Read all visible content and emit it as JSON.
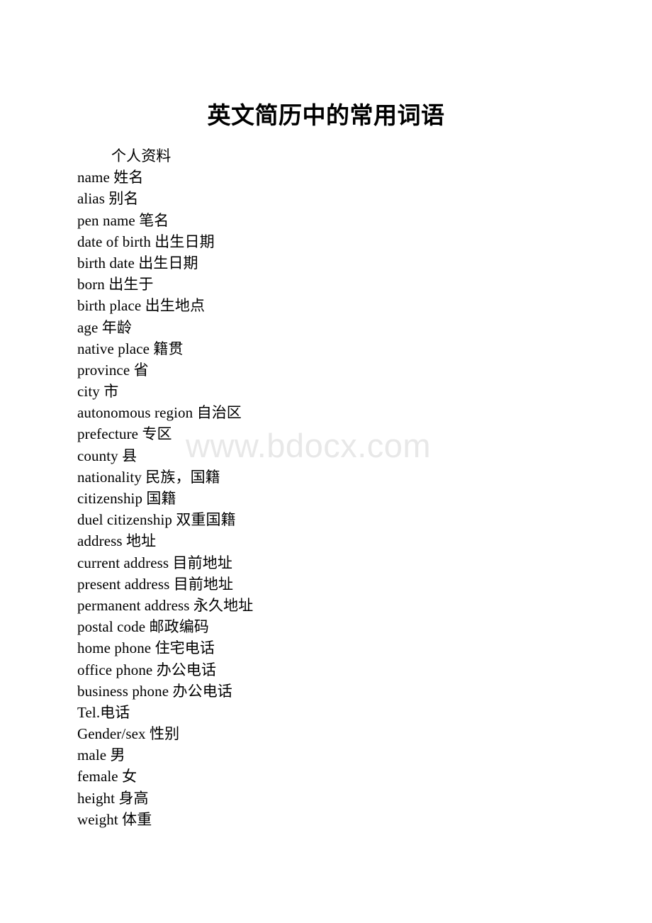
{
  "document": {
    "title": "英文简历中的常用词语",
    "watermark": "www.bdocx.com",
    "section_heading": "个人资料",
    "lines": [
      "个人资料",
      "name 姓名",
      "alias 别名",
      "pen name 笔名",
      "date of birth 出生日期",
      "birth date 出生日期",
      "born 出生于",
      "birth place 出生地点",
      "age 年龄",
      "native place 籍贯",
      "province 省",
      "city 市",
      "autonomous region 自治区",
      "prefecture 专区",
      "county 县",
      "nationality 民族，国籍",
      "citizenship 国籍",
      "duel citizenship 双重国籍",
      "address 地址",
      "current address 目前地址",
      "present address 目前地址",
      "permanent address 永久地址",
      "postal code 邮政编码",
      "home phone 住宅电话",
      "office phone 办公电话",
      "business phone 办公电话",
      "Tel.电话",
      "Gender/sex 性别",
      "male 男",
      "female 女",
      "height 身高",
      "weight 体重"
    ]
  },
  "colors": {
    "page_background": "#ffffff",
    "text": "#000000",
    "watermark": "#e8e8e8"
  }
}
